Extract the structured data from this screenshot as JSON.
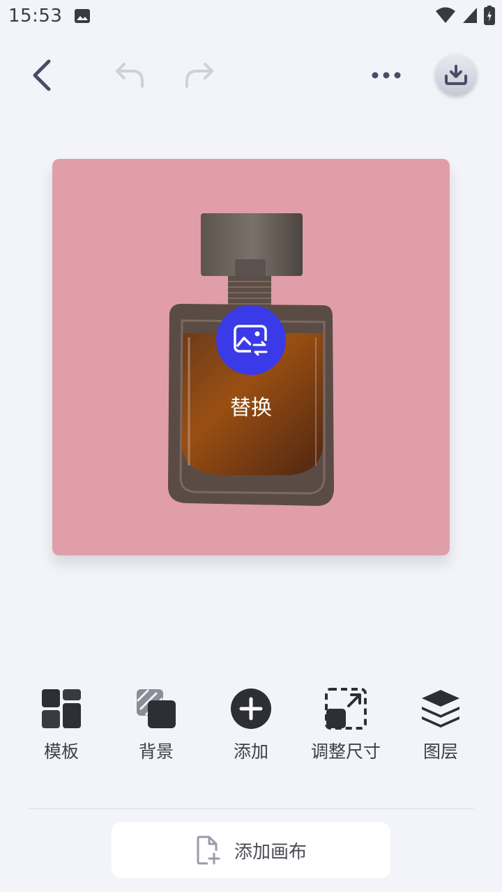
{
  "status_bar": {
    "time": "15:53",
    "icons": [
      "gallery-icon",
      "wifi-icon",
      "signal-icon",
      "battery-charging-icon"
    ]
  },
  "toolbar": {
    "icons": [
      "back-arrow-icon",
      "undo-icon",
      "redo-icon",
      "more-icon",
      "download-icon"
    ]
  },
  "canvas": {
    "background_color": "#e09ea9",
    "replace_label": "替换",
    "replace_button_color": "#3a3ae8"
  },
  "tools": [
    {
      "label": "模板",
      "icon": "template-grid-icon"
    },
    {
      "label": "背景",
      "icon": "background-icon"
    },
    {
      "label": "添加",
      "icon": "add-circle-icon"
    },
    {
      "label": "调整尺寸",
      "icon": "resize-icon"
    },
    {
      "label": "图层",
      "icon": "layers-icon"
    }
  ],
  "add_canvas": {
    "label": "添加画布",
    "icon": "add-file-icon"
  }
}
